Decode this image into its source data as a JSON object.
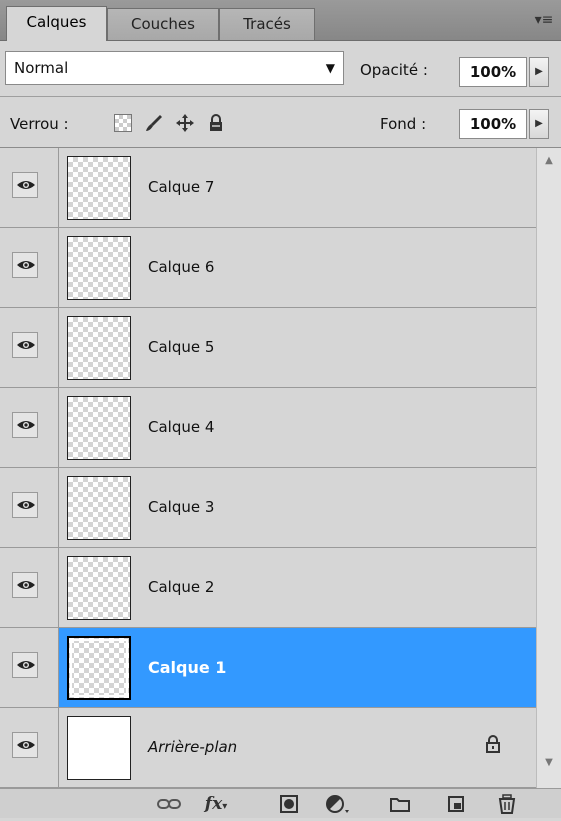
{
  "tabs": [
    {
      "label": "Calques",
      "active": true
    },
    {
      "label": "Couches",
      "active": false
    },
    {
      "label": "Tracés",
      "active": false
    }
  ],
  "panel_menu_icon": "panel-menu-icon",
  "blend": {
    "mode": "Normal",
    "opacity_label": "Opacité :",
    "opacity_value": "100%"
  },
  "lock": {
    "label": "Verrou :",
    "icons": [
      "lock-transparency-icon",
      "lock-paint-icon",
      "lock-move-icon",
      "lock-all-icon"
    ],
    "fill_label": "Fond :",
    "fill_value": "100%"
  },
  "layers": [
    {
      "name": "Calque 7",
      "visible": true,
      "selected": false
    },
    {
      "name": "Calque 6",
      "visible": true,
      "selected": false
    },
    {
      "name": "Calque 5",
      "visible": true,
      "selected": false
    },
    {
      "name": "Calque 4",
      "visible": true,
      "selected": false
    },
    {
      "name": "Calque 3",
      "visible": true,
      "selected": false
    },
    {
      "name": "Calque 2",
      "visible": true,
      "selected": false
    },
    {
      "name": "Calque 1",
      "visible": true,
      "selected": true
    },
    {
      "name": "Arrière-plan",
      "visible": true,
      "selected": false,
      "locked": true
    }
  ],
  "colors": {
    "selection": "#3399ff",
    "panel_bg": "#d6d6d6"
  },
  "bottom_toolbar": {
    "icons": [
      "link-layers-icon",
      "layer-style-icon",
      "layer-mask-icon",
      "adjustment-layer-icon",
      "group-icon",
      "new-layer-icon",
      "delete-layer-icon"
    ],
    "fx_label": "fx"
  }
}
